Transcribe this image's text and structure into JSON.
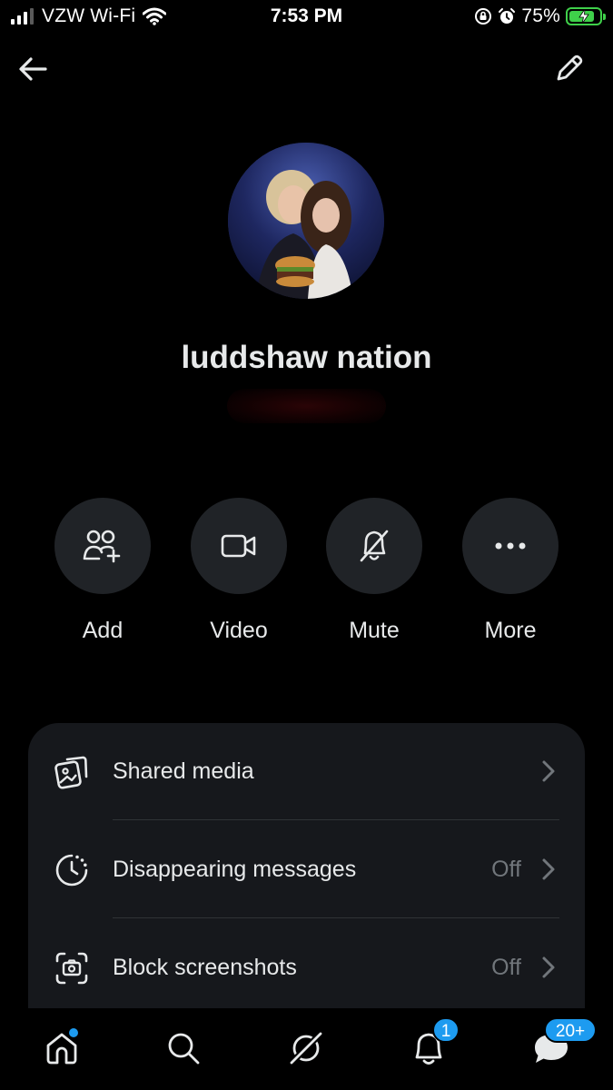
{
  "status_bar": {
    "carrier": "VZW Wi-Fi",
    "time": "7:53 PM",
    "battery": "75%",
    "battery_level": 0.75,
    "colors": {
      "battery": "#3fd04a"
    }
  },
  "header": {
    "back_icon": "arrow-left-icon",
    "edit_icon": "pencil-icon"
  },
  "profile": {
    "group_name": "luddshaw nation"
  },
  "actions": [
    {
      "label": "Add",
      "icon": "add-people-icon"
    },
    {
      "label": "Video",
      "icon": "video-camera-icon"
    },
    {
      "label": "Mute",
      "icon": "bell-off-icon"
    },
    {
      "label": "More",
      "icon": "more-dots-icon"
    }
  ],
  "settings": [
    {
      "label": "Shared media",
      "value": "",
      "icon": "shared-media-icon"
    },
    {
      "label": "Disappearing messages",
      "value": "Off",
      "icon": "timer-icon"
    },
    {
      "label": "Block screenshots",
      "value": "Off",
      "icon": "screenshot-icon"
    }
  ],
  "bottom_nav": {
    "items": [
      "home-icon",
      "search-icon",
      "grok-icon",
      "notifications-icon",
      "messages-icon"
    ],
    "notifications_badge": "1",
    "messages_badge": "20+"
  },
  "colors": {
    "accent": "#1d9bf0",
    "background": "#000000",
    "card": "#16181c",
    "action_circle": "#202327",
    "secondary_text": "#71767b"
  }
}
